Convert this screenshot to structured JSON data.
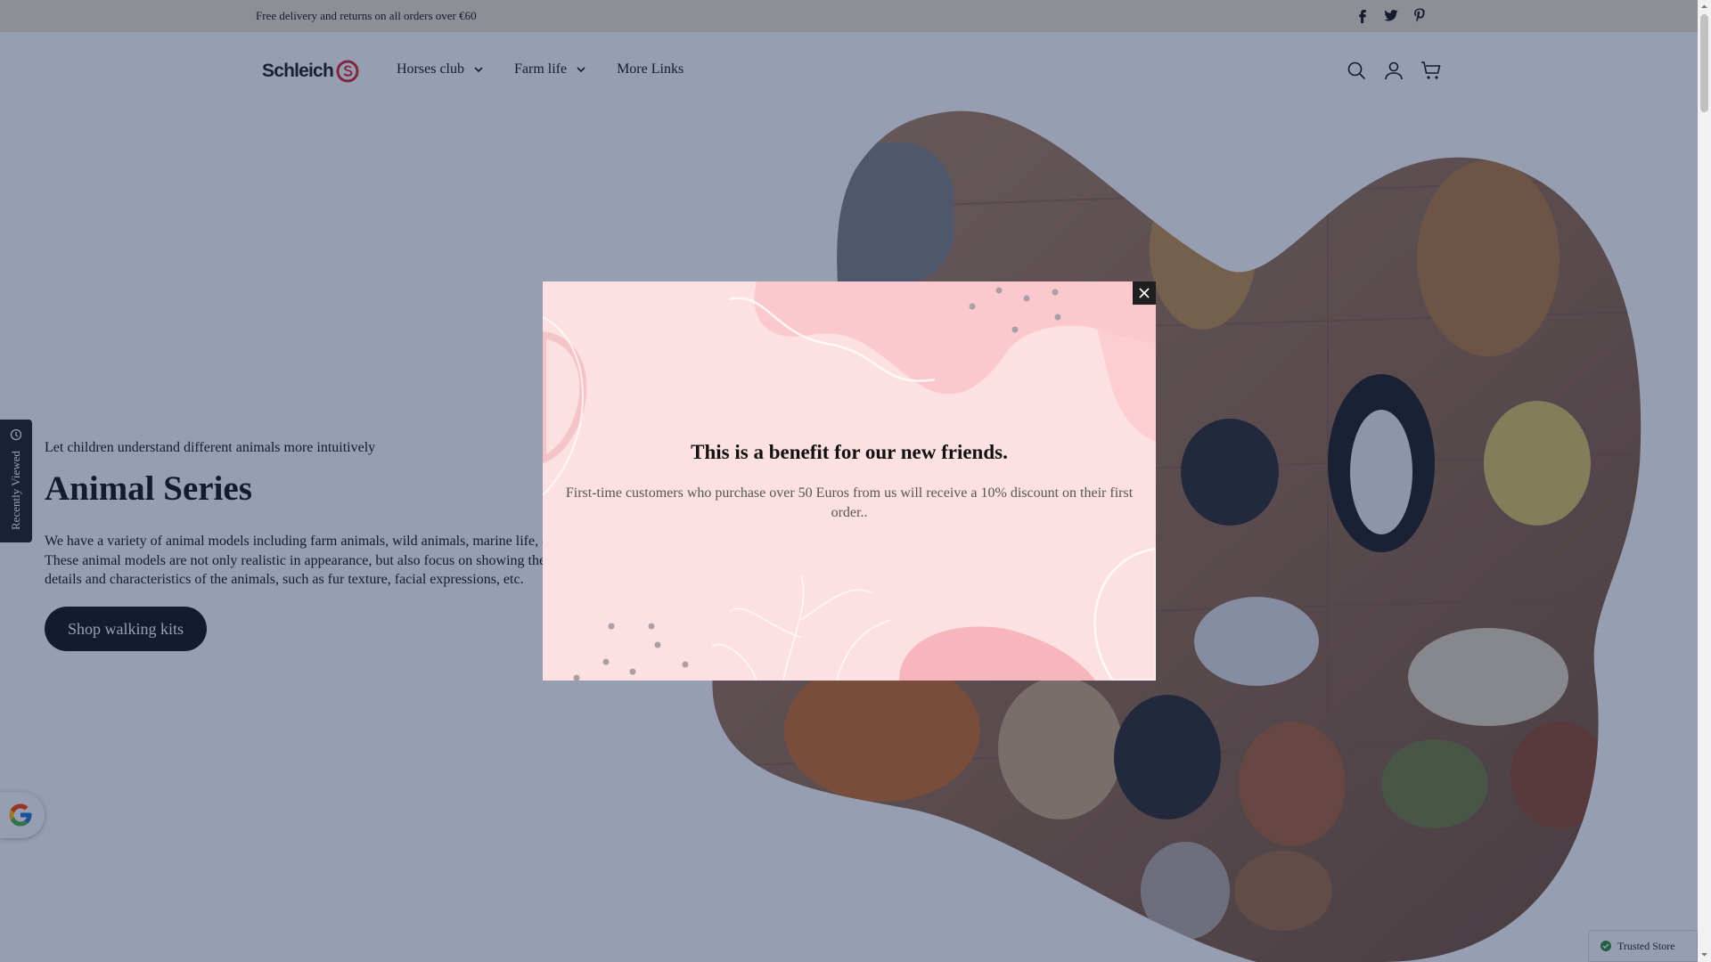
{
  "announcement": {
    "text": "Free delivery and returns on all orders over €60"
  },
  "social": {
    "icons": [
      "facebook-icon",
      "twitter-icon",
      "pinterest-icon"
    ]
  },
  "header": {
    "logo_text": "Schleich",
    "nav": [
      {
        "label": "Horses club",
        "has_dropdown": true
      },
      {
        "label": "Farm life",
        "has_dropdown": true
      },
      {
        "label": "More Links",
        "has_dropdown": false
      }
    ],
    "icons": [
      "search-icon",
      "account-icon",
      "cart-icon"
    ]
  },
  "hero": {
    "subtitle": "Let children understand different animals more intuitively",
    "title": "Animal Series",
    "description": "We have a variety of animal models including farm animals, wild animals, marine life, etc. These animal models are not only realistic in appearance, but also focus on showing the details and characteristics of the animals, such as fur texture, facial expressions, etc.",
    "button_label": "Shop walking kits"
  },
  "recently_viewed": {
    "label": "Recently Viewed"
  },
  "trusted_badge": {
    "label": "Trusted Store"
  },
  "modal": {
    "title": "This is a benefit for our new friends.",
    "text": "First-time customers who purchase over 50 Euros from us will receive a 10% discount on their first order.."
  },
  "colors": {
    "announcement_bg": "#ece4cf",
    "overlay": "#1a2852",
    "modal_bg": "#fde0e2",
    "brand_red": "#d6252e",
    "button_bg": "#111111"
  }
}
